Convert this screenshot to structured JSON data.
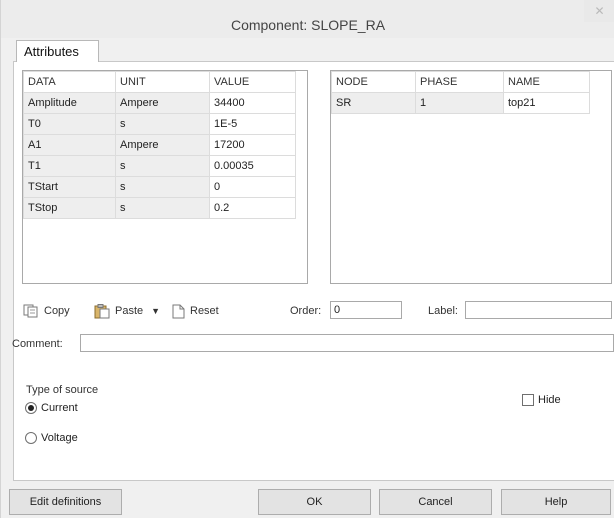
{
  "window": {
    "title": "Component: SLOPE_RA",
    "close_icon": "close-icon"
  },
  "tabs": [
    {
      "label": "Attributes",
      "active": true
    }
  ],
  "attributes": {
    "columns": [
      "DATA",
      "UNIT",
      "VALUE"
    ],
    "rows": [
      {
        "data": "Amplitude",
        "unit": "Ampere",
        "value": "34400"
      },
      {
        "data": "T0",
        "unit": "s",
        "value": "1E-5"
      },
      {
        "data": "A1",
        "unit": "Ampere",
        "value": "17200"
      },
      {
        "data": "T1",
        "unit": "s",
        "value": "0.00035"
      },
      {
        "data": "TStart",
        "unit": "s",
        "value": "0"
      },
      {
        "data": "TStop",
        "unit": "s",
        "value": "0.2"
      }
    ]
  },
  "nodes": {
    "columns": [
      "NODE",
      "PHASE",
      "NAME"
    ],
    "rows": [
      {
        "node": "SR",
        "phase": "1",
        "name": "top21"
      }
    ]
  },
  "toolbar": {
    "copy_label": "Copy",
    "paste_label": "Paste",
    "reset_label": "Reset"
  },
  "order": {
    "label": "Order:",
    "value": "0"
  },
  "label_field": {
    "label": "Label:",
    "value": ""
  },
  "comment": {
    "label": "Comment:",
    "value": ""
  },
  "source": {
    "group_label": "Type of source",
    "options": [
      {
        "label": "Current",
        "checked": true
      },
      {
        "label": "Voltage",
        "checked": false
      }
    ],
    "hide_label": "Hide",
    "hide_checked": false
  },
  "buttons": {
    "edit_definitions": "Edit definitions",
    "ok": "OK",
    "cancel": "Cancel",
    "help": "Help"
  }
}
